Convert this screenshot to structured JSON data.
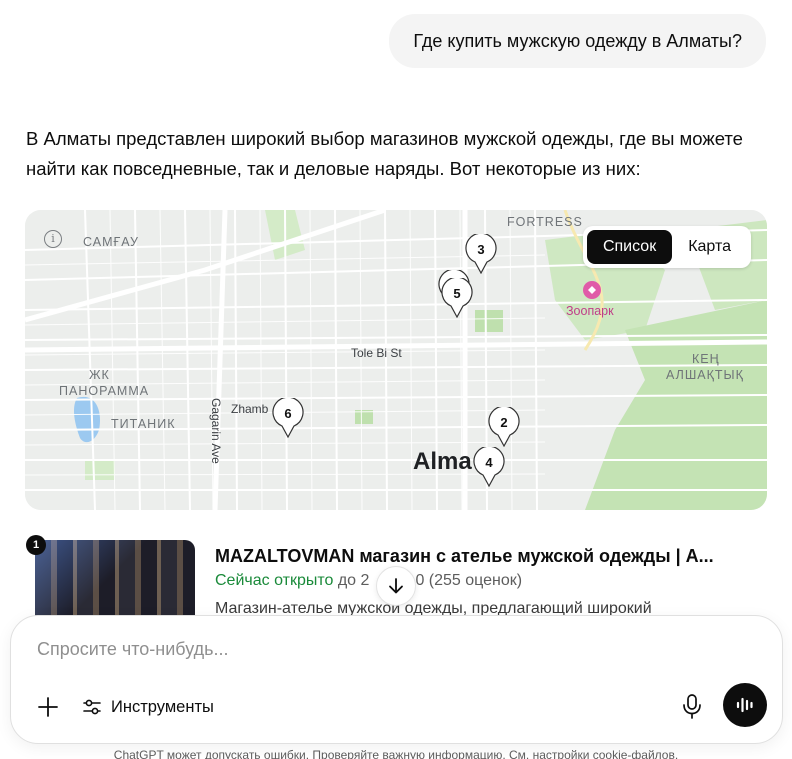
{
  "user_message": "Где купить мужскую одежду в Алматы?",
  "answer_intro": "В Алматы представлен широкий выбор магазинов мужской одежды, где вы можете найти как повседневные, так и деловые наряды. Вот некоторые из них:",
  "map": {
    "view_toggle": {
      "list_label": "Список",
      "map_label": "Карта",
      "active": "list"
    },
    "labels": {
      "samal": "САМҒАУ",
      "fortress": "FORTRESS",
      "zoo": "Зоопарк",
      "tole_bi": "Tole Bi St",
      "zhk": "ЖК",
      "panorama": "ПАНОРАММА",
      "titanic": "ТИТАНИК",
      "zhambyl": "Zhamb",
      "gagarin": "Gagarin Ave",
      "keng": "КЕҢ",
      "alshaqtyq": "АЛШАҚТЫҚ",
      "city": "Alma"
    },
    "pins": [
      "3",
      "5",
      "6",
      "2",
      "4"
    ],
    "colors": {
      "park": "#c4e3b4",
      "water": "#9cc9f0",
      "road": "#ffffff",
      "zoo": "#c03e88"
    }
  },
  "results": [
    {
      "rank": "1",
      "title": "MAZALTOVMAN магазин с ателье мужской одежды | А...",
      "status": "Сейчас открыто",
      "hours_prefix": "до 2",
      "rating": "· 5.0 (255 оценок)",
      "description": "Магазин-ателье мужской одежды, предлагающий широкий"
    }
  ],
  "composer": {
    "placeholder": "Спросите что-нибудь...",
    "tools_label": "Инструменты"
  },
  "footer_text": "ChatGPT может допускать ошибки. Проверяйте важную информацию. См. настройки cookie-файлов."
}
